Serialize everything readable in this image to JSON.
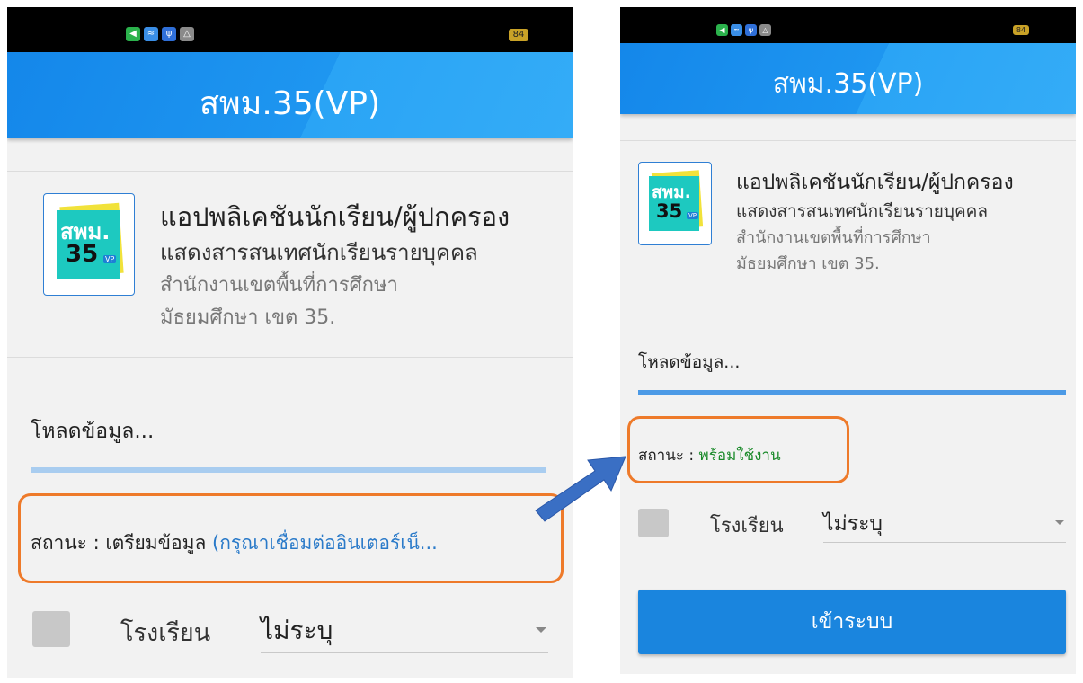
{
  "before": {
    "app_title": "สพม.35(VP)",
    "battery": "84",
    "status_icons": [
      "navigation-icon",
      "gallery-icon",
      "usb-icon",
      "recycle-icon"
    ],
    "logo_text_1": "สพม.",
    "logo_text_2": "35",
    "logo_text_3": "VP",
    "app_name": "แอปพลิเคชันนักเรียน/ผู้ปกครอง",
    "app_desc": "แสดงสารสนเทศนักเรียนรายบุคคล",
    "office_line1": "สำนักงานเขตพื้นที่การศึกษา",
    "office_line2": "มัธยมศึกษา เขต 35.",
    "loading_text": "โหลดข้อมูล...",
    "status_label": "สถานะ : เตรียมข้อมูล",
    "status_value": "(กรุณาเชื่อมต่ออินเตอร์เน็...",
    "school_label": "โรงเรียน",
    "school_value": "ไม่ระบุ"
  },
  "after": {
    "app_title": "สพม.35(VP)",
    "battery": "84",
    "status_icons": [
      "navigation-icon",
      "gallery-icon",
      "usb-icon",
      "recycle-icon"
    ],
    "logo_text_1": "สพม.",
    "logo_text_2": "35",
    "logo_text_3": "VP",
    "app_name": "แอปพลิเคชันนักเรียน/ผู้ปกครอง",
    "app_desc": "แสดงสารสนเทศนักเรียนรายบุคคล",
    "office_line1": "สำนักงานเขตพื้นที่การศึกษา",
    "office_line2": "มัธยมศึกษา เขต 35.",
    "loading_text": "โหลดข้อมูล...",
    "status_label": "สถานะ :",
    "status_value": "พร้อมใช้งาน",
    "school_label": "โรงเรียน",
    "school_value": "ไม่ระบุ",
    "login_label": "เข้าระบบ"
  },
  "colors": {
    "appbar": "#1e96f0",
    "highlight": "#ee7a2a",
    "arrow": "#3a6fc4",
    "status_pending": "#2a7ac9",
    "status_ready": "#1a8a2a",
    "login_button": "#1a85de"
  }
}
